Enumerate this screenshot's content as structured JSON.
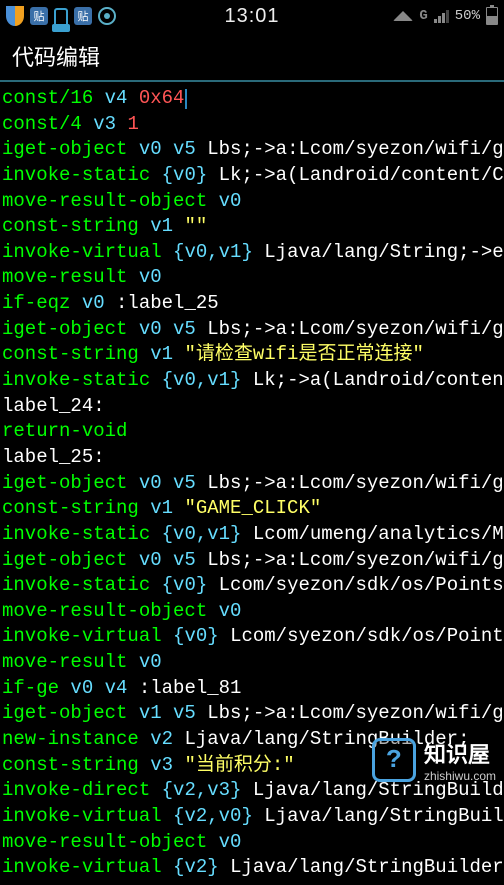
{
  "status": {
    "time": "13:01",
    "network_type": "G",
    "battery_text": "50%"
  },
  "header": {
    "title": "代码编辑"
  },
  "code": {
    "lines": [
      {
        "tokens": [
          {
            "t": "const/16",
            "c": "c-green"
          },
          {
            "t": " v4 ",
            "c": "c-cyan"
          },
          {
            "t": "0x64",
            "c": "c-red"
          }
        ],
        "cursor": true
      },
      {
        "tokens": [
          {
            "t": "const/4",
            "c": "c-green"
          },
          {
            "t": " v3 ",
            "c": "c-cyan"
          },
          {
            "t": "1",
            "c": "c-red"
          }
        ]
      },
      {
        "tokens": [
          {
            "t": "iget-object",
            "c": "c-green"
          },
          {
            "t": " v0 v5 ",
            "c": "c-cyan"
          },
          {
            "t": "Lbs;->a:Lcom/syezon/wifi/ga",
            "c": "c-white"
          }
        ]
      },
      {
        "tokens": [
          {
            "t": "invoke-static",
            "c": "c-green"
          },
          {
            "t": " {v0} ",
            "c": "c-cyan"
          },
          {
            "t": "Lk;->a(Landroid/content/Co",
            "c": "c-white"
          }
        ]
      },
      {
        "tokens": [
          {
            "t": "move-result-object",
            "c": "c-green"
          },
          {
            "t": " v0",
            "c": "c-cyan"
          }
        ]
      },
      {
        "tokens": [
          {
            "t": "const-string",
            "c": "c-green"
          },
          {
            "t": " v1 ",
            "c": "c-cyan"
          },
          {
            "t": "\"\"",
            "c": "c-yellow"
          }
        ]
      },
      {
        "tokens": [
          {
            "t": "invoke-virtual",
            "c": "c-green"
          },
          {
            "t": " {v0,v1} ",
            "c": "c-cyan"
          },
          {
            "t": "Ljava/lang/String;->eq",
            "c": "c-white"
          }
        ]
      },
      {
        "tokens": [
          {
            "t": "move-result",
            "c": "c-green"
          },
          {
            "t": " v0",
            "c": "c-cyan"
          }
        ]
      },
      {
        "tokens": [
          {
            "t": "if-eqz",
            "c": "c-green"
          },
          {
            "t": " v0 ",
            "c": "c-cyan"
          },
          {
            "t": ":label_25",
            "c": "c-white"
          }
        ]
      },
      {
        "tokens": [
          {
            "t": "iget-object",
            "c": "c-green"
          },
          {
            "t": " v0 v5 ",
            "c": "c-cyan"
          },
          {
            "t": "Lbs;->a:Lcom/syezon/wifi/ga",
            "c": "c-white"
          }
        ]
      },
      {
        "tokens": [
          {
            "t": "const-string",
            "c": "c-green"
          },
          {
            "t": " v1 ",
            "c": "c-cyan"
          },
          {
            "t": "\"请检查wifi是否正常连接\"",
            "c": "c-yellow"
          }
        ]
      },
      {
        "tokens": [
          {
            "t": "invoke-static",
            "c": "c-green"
          },
          {
            "t": " {v0,v1} ",
            "c": "c-cyan"
          },
          {
            "t": "Lk;->a(Landroid/content",
            "c": "c-white"
          }
        ]
      },
      {
        "tokens": [
          {
            "t": "label_24:",
            "c": "c-white"
          }
        ]
      },
      {
        "tokens": [
          {
            "t": "return-void",
            "c": "c-green"
          }
        ]
      },
      {
        "tokens": [
          {
            "t": "label_25:",
            "c": "c-white"
          }
        ]
      },
      {
        "tokens": [
          {
            "t": "iget-object",
            "c": "c-green"
          },
          {
            "t": " v0 v5 ",
            "c": "c-cyan"
          },
          {
            "t": "Lbs;->a:Lcom/syezon/wifi/ga",
            "c": "c-white"
          }
        ]
      },
      {
        "tokens": [
          {
            "t": "const-string",
            "c": "c-green"
          },
          {
            "t": " v1 ",
            "c": "c-cyan"
          },
          {
            "t": "\"GAME_CLICK\"",
            "c": "c-yellow"
          }
        ]
      },
      {
        "tokens": [
          {
            "t": "invoke-static",
            "c": "c-green"
          },
          {
            "t": " {v0,v1} ",
            "c": "c-cyan"
          },
          {
            "t": "Lcom/umeng/analytics/Mo",
            "c": "c-white"
          }
        ]
      },
      {
        "tokens": [
          {
            "t": "iget-object",
            "c": "c-green"
          },
          {
            "t": " v0 v5 ",
            "c": "c-cyan"
          },
          {
            "t": "Lbs;->a:Lcom/syezon/wifi/ga",
            "c": "c-white"
          }
        ]
      },
      {
        "tokens": [
          {
            "t": "invoke-static",
            "c": "c-green"
          },
          {
            "t": " {v0} ",
            "c": "c-cyan"
          },
          {
            "t": "Lcom/syezon/sdk/os/PointsM",
            "c": "c-white"
          }
        ]
      },
      {
        "tokens": [
          {
            "t": "move-result-object",
            "c": "c-green"
          },
          {
            "t": " v0",
            "c": "c-cyan"
          }
        ]
      },
      {
        "tokens": [
          {
            "t": "invoke-virtual",
            "c": "c-green"
          },
          {
            "t": " {v0} ",
            "c": "c-cyan"
          },
          {
            "t": "Lcom/syezon/sdk/os/Points",
            "c": "c-white"
          }
        ]
      },
      {
        "tokens": [
          {
            "t": "move-result",
            "c": "c-green"
          },
          {
            "t": " v0",
            "c": "c-cyan"
          }
        ]
      },
      {
        "tokens": [
          {
            "t": "if-ge",
            "c": "c-green"
          },
          {
            "t": " v0 v4 ",
            "c": "c-cyan"
          },
          {
            "t": ":label_81",
            "c": "c-white"
          }
        ]
      },
      {
        "tokens": [
          {
            "t": "iget-object",
            "c": "c-green"
          },
          {
            "t": " v1 v5 ",
            "c": "c-cyan"
          },
          {
            "t": "Lbs;->a:Lcom/syezon/wifi/ga",
            "c": "c-white"
          }
        ]
      },
      {
        "tokens": [
          {
            "t": "new-instance",
            "c": "c-green"
          },
          {
            "t": " v2 ",
            "c": "c-cyan"
          },
          {
            "t": "Ljava/lang/StringBuilder;",
            "c": "c-white"
          }
        ]
      },
      {
        "tokens": [
          {
            "t": "const-string",
            "c": "c-green"
          },
          {
            "t": " v3 ",
            "c": "c-cyan"
          },
          {
            "t": "\"当前积分:\"",
            "c": "c-yellow"
          }
        ]
      },
      {
        "tokens": [
          {
            "t": "invoke-direct",
            "c": "c-green"
          },
          {
            "t": " {v2,v3} ",
            "c": "c-cyan"
          },
          {
            "t": "Ljava/lang/StringBuilde",
            "c": "c-white"
          }
        ]
      },
      {
        "tokens": [
          {
            "t": "invoke-virtual",
            "c": "c-green"
          },
          {
            "t": " {v2,v0} ",
            "c": "c-cyan"
          },
          {
            "t": "Ljava/lang/StringBuild",
            "c": "c-white"
          }
        ]
      },
      {
        "tokens": [
          {
            "t": "move-result-object",
            "c": "c-green"
          },
          {
            "t": " v0",
            "c": "c-cyan"
          }
        ]
      },
      {
        "tokens": [
          {
            "t": "invoke-virtual",
            "c": "c-green"
          },
          {
            "t": " {v2} ",
            "c": "c-cyan"
          },
          {
            "t": "Ljava/lang/StringBuilder;",
            "c": "c-white"
          }
        ]
      }
    ]
  },
  "watermark": {
    "icon_symbol": "?",
    "title": "知识屋",
    "subtitle": "zhishiwu.com"
  }
}
